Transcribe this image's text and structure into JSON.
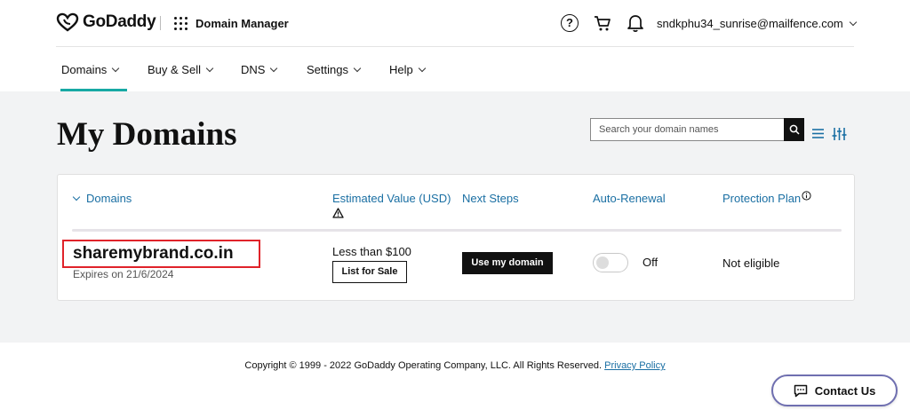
{
  "header": {
    "brand": "GoDaddy",
    "app_name": "Domain Manager",
    "account_email": "sndkphu34_sunrise@mailfence.com"
  },
  "nav": {
    "items": [
      {
        "label": "Domains",
        "active": true
      },
      {
        "label": "Buy & Sell"
      },
      {
        "label": "DNS"
      },
      {
        "label": "Settings"
      },
      {
        "label": "Help"
      }
    ]
  },
  "main": {
    "title": "My Domains",
    "search": {
      "placeholder": "Search your domain names",
      "value": ""
    }
  },
  "table": {
    "columns": {
      "domains": "Domains",
      "estimated_value": "Estimated Value (USD)",
      "next_steps": "Next Steps",
      "auto_renewal": "Auto-Renewal",
      "protection_plan": "Protection Plan"
    },
    "rows": [
      {
        "domain": "sharemybrand.co.in",
        "expires": "Expires on 21/6/2024",
        "estimated_value": "Less than $100",
        "list_for_sale_label": "List for Sale",
        "next_step_label": "Use my domain",
        "auto_renewal": "Off",
        "protection": "Not eligible"
      }
    ]
  },
  "footer": {
    "copyright": "Copyright © 1999 - 2022 GoDaddy Operating Company, LLC. All Rights Reserved.",
    "privacy_link": "Privacy Policy",
    "contact_label": "Contact Us"
  },
  "colors": {
    "accent_teal": "#17a9a4",
    "link_blue": "#1a6fa3",
    "highlight_red": "#e0232a",
    "contact_border": "#6f6fb0"
  },
  "icons": [
    "godaddy-logo-icon",
    "app-grid-icon",
    "help-icon",
    "cart-icon",
    "bell-icon",
    "chevron-down-icon",
    "search-icon",
    "list-view-icon",
    "filter-icon",
    "warning-icon",
    "info-icon",
    "chat-icon"
  ]
}
